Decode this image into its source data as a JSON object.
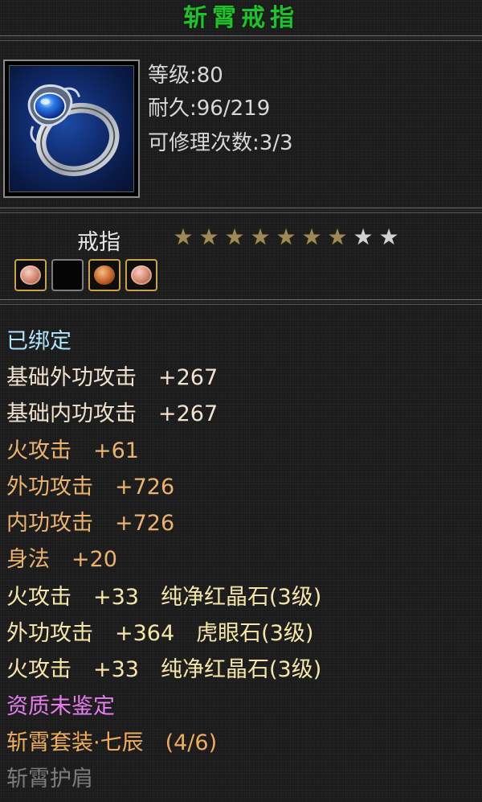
{
  "item": {
    "name": "斩霄戒指",
    "level": "等级:80",
    "durability": "耐久:96/219",
    "repair": "可修理次数:3/3",
    "type": "戒指",
    "stars_lit": 7,
    "stars_total": 9
  },
  "sockets": [
    {
      "state": "gem",
      "color": "pink"
    },
    {
      "state": "empty"
    },
    {
      "state": "gem",
      "color": "amber"
    },
    {
      "state": "gem",
      "color": "pink"
    }
  ],
  "attributes": {
    "bound": "已绑定",
    "base_outer": "基础外功攻击　+267",
    "base_inner": "基础内功攻击　+267",
    "fire": "火攻击　+61",
    "outer": "外功攻击　+726",
    "inner": "内功攻击　+726",
    "agility": "身法　+20",
    "gem1": "火攻击　+33　纯净红晶石(3级)",
    "gem2": "外功攻击　+364　虎眼石(3级)",
    "gem3": "火攻击　+33　纯净红晶石(3级)",
    "quality": "资质未鉴定",
    "set_name": "斩霄套装·七辰　(4/6)",
    "set_piece": "斩霄护肩"
  }
}
